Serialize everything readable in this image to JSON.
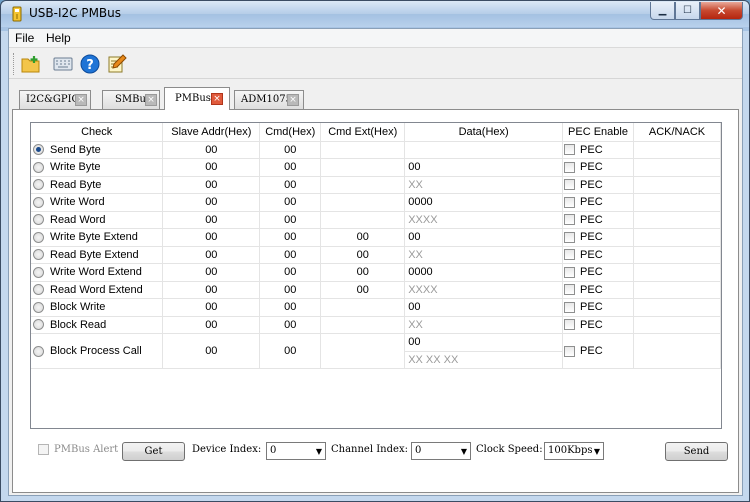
{
  "window": {
    "title": "USB-I2C PMBus"
  },
  "menu": [
    "File",
    "Help"
  ],
  "toolbar": [
    {
      "icon": "folder-add-icon"
    },
    {
      "icon": "keyboard-icon"
    },
    {
      "icon": "help-icon"
    },
    {
      "icon": "notepad-icon"
    }
  ],
  "tabs": [
    {
      "label": "I2C&GPIO",
      "active": false
    },
    {
      "label": "SMBus",
      "active": false
    },
    {
      "label": "PMBus",
      "active": true
    },
    {
      "label": "ADM1075",
      "active": false
    }
  ],
  "table": {
    "headers": [
      "Check",
      "Slave Addr(Hex)",
      "Cmd(Hex)",
      "Cmd Ext(Hex)",
      "Data(Hex)",
      "PEC Enable",
      "ACK/NACK"
    ],
    "rows": [
      {
        "name": "Send Byte",
        "addr": "00",
        "cmd": "00",
        "ext": "",
        "data": "",
        "data_gray": false,
        "pec": "PEC",
        "selected": true
      },
      {
        "name": "Write Byte",
        "addr": "00",
        "cmd": "00",
        "ext": "",
        "data": "00",
        "data_gray": false,
        "pec": "PEC",
        "selected": false
      },
      {
        "name": "Read Byte",
        "addr": "00",
        "cmd": "00",
        "ext": "",
        "data": "XX",
        "data_gray": true,
        "pec": "PEC",
        "selected": false
      },
      {
        "name": "Write Word",
        "addr": "00",
        "cmd": "00",
        "ext": "",
        "data": "0000",
        "data_gray": false,
        "pec": "PEC",
        "selected": false
      },
      {
        "name": "Read Word",
        "addr": "00",
        "cmd": "00",
        "ext": "",
        "data": "XXXX",
        "data_gray": true,
        "pec": "PEC",
        "selected": false
      },
      {
        "name": "Write Byte Extend",
        "addr": "00",
        "cmd": "00",
        "ext": "00",
        "data": "00",
        "data_gray": false,
        "pec": "PEC",
        "selected": false
      },
      {
        "name": "Read Byte Extend",
        "addr": "00",
        "cmd": "00",
        "ext": "00",
        "data": "XX",
        "data_gray": true,
        "pec": "PEC",
        "selected": false
      },
      {
        "name": "Write Word Extend",
        "addr": "00",
        "cmd": "00",
        "ext": "00",
        "data": "0000",
        "data_gray": false,
        "pec": "PEC",
        "selected": false
      },
      {
        "name": "Read Word Extend",
        "addr": "00",
        "cmd": "00",
        "ext": "00",
        "data": "XXXX",
        "data_gray": true,
        "pec": "PEC",
        "selected": false
      },
      {
        "name": "Block Write",
        "addr": "00",
        "cmd": "00",
        "ext": "",
        "data": "00",
        "data_gray": false,
        "pec": "PEC",
        "selected": false
      },
      {
        "name": "Block Read",
        "addr": "00",
        "cmd": "00",
        "ext": "",
        "data": "XX",
        "data_gray": true,
        "pec": "PEC",
        "selected": false
      }
    ],
    "block_process": {
      "name": "Block Process Call",
      "addr": "00",
      "cmd": "00",
      "data_write": "00",
      "data_read": "XX XX XX",
      "pec": "PEC"
    }
  },
  "bottom": {
    "pmbus_alert": "PMBus Alert",
    "get": "Get",
    "device_index_label": "Device Index:",
    "device_index": "0",
    "channel_index_label": "Channel Index:",
    "channel_index": "0",
    "clock_speed_label": "Clock Speed:",
    "clock_speed": "100Kbps",
    "send": "Send"
  }
}
